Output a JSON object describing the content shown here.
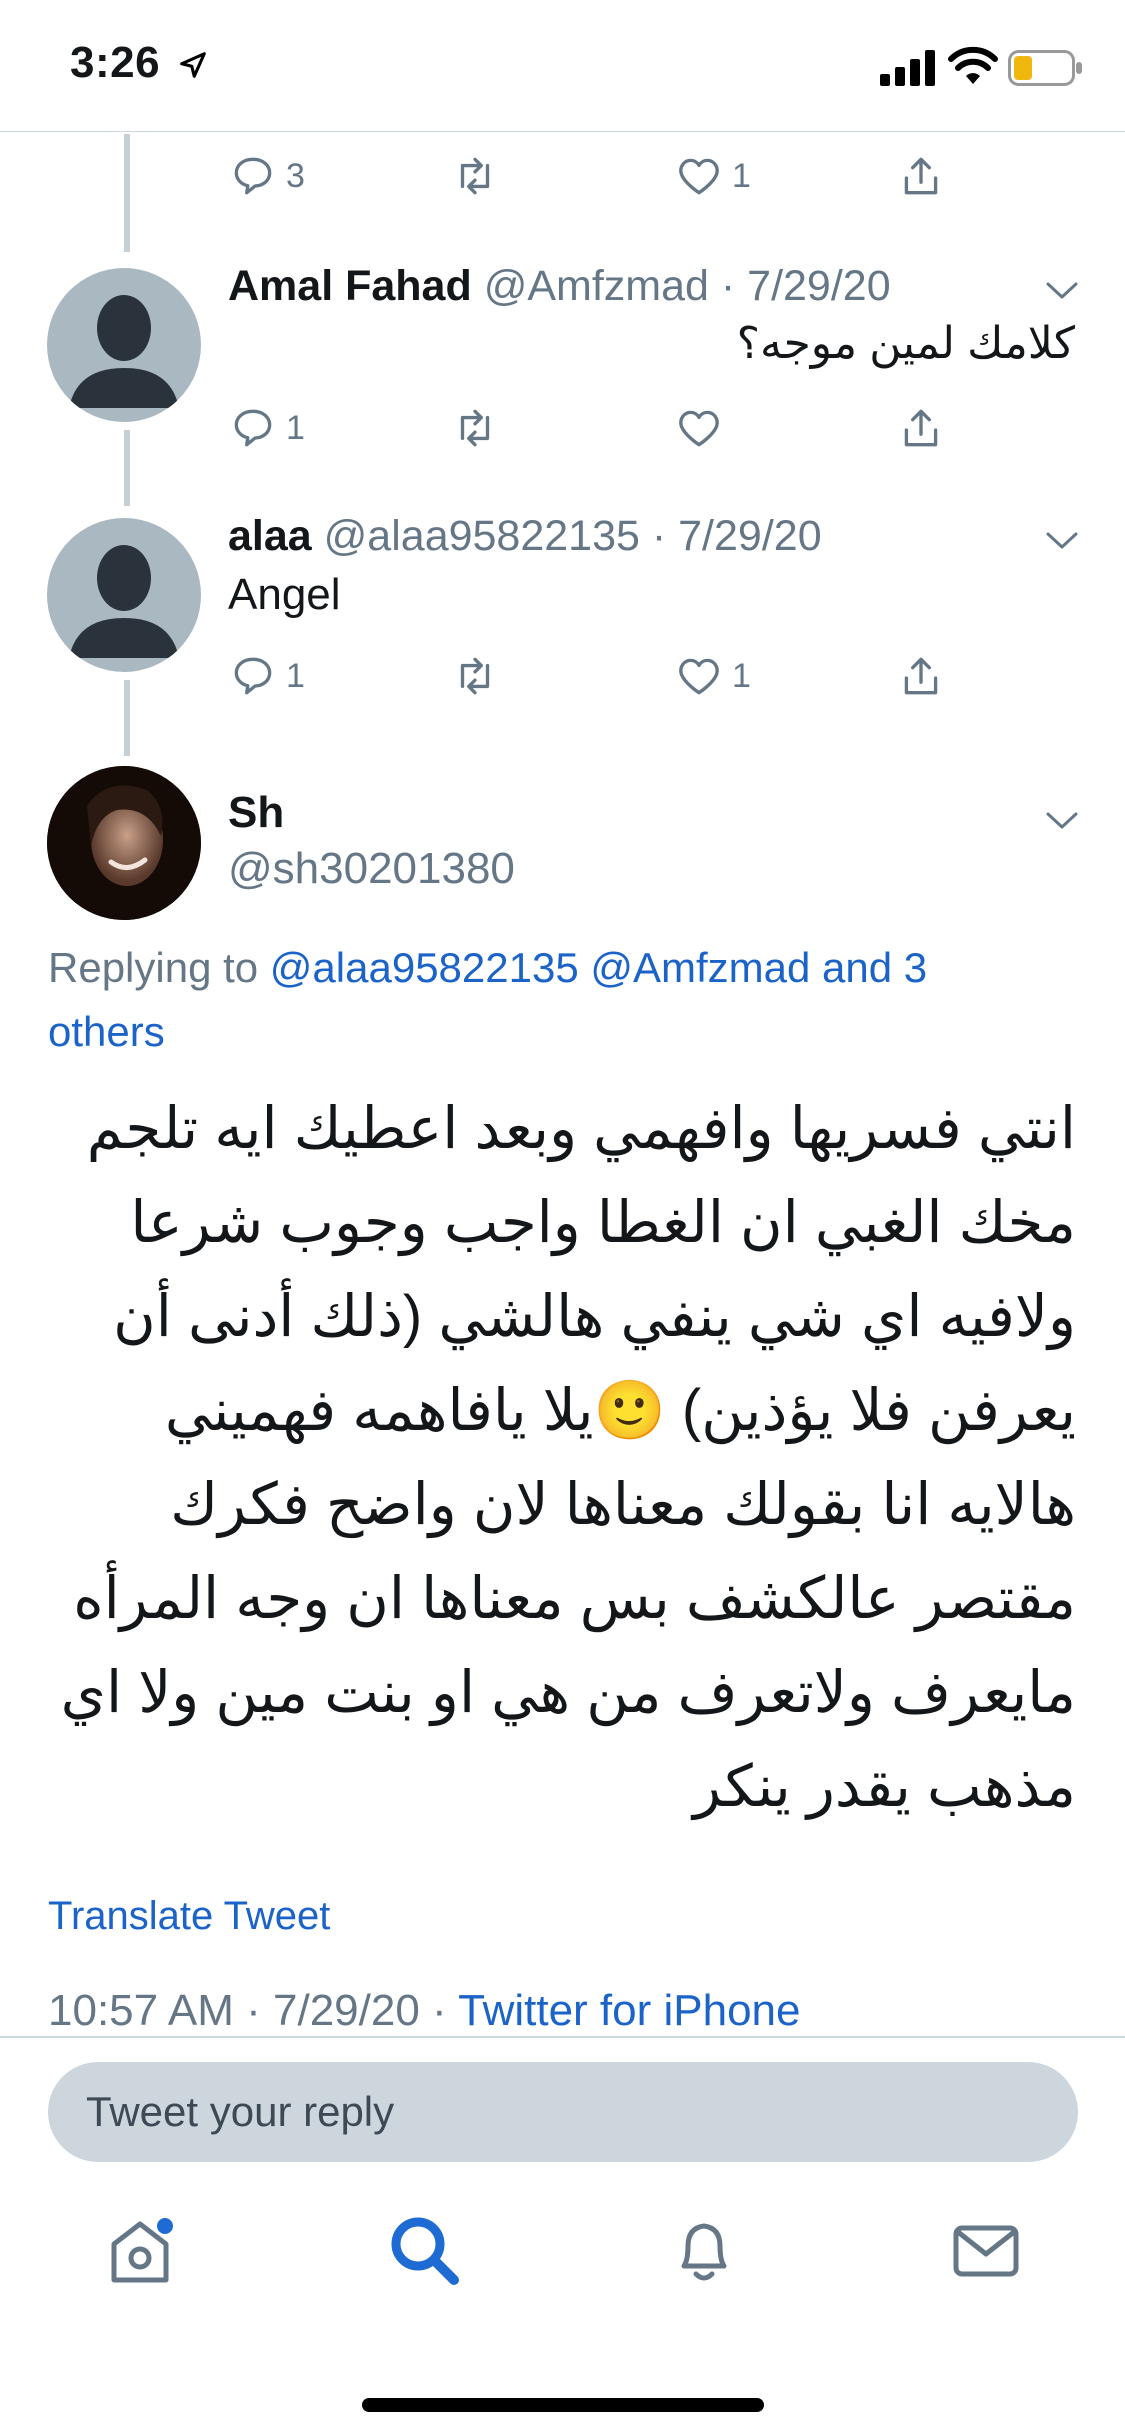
{
  "status_bar": {
    "time": "3:26"
  },
  "tweets": [
    {
      "actions": {
        "reply": "3",
        "retweet": "",
        "like": "1"
      }
    },
    {
      "name": "Amal Fahad",
      "handle": "@Amfzmad",
      "date": "· 7/29/20",
      "text": "كلامك لمين موجه؟",
      "actions": {
        "reply": "1",
        "retweet": "",
        "like": ""
      }
    },
    {
      "name": "alaa",
      "handle": "@alaa95822135",
      "date": "· 7/29/20",
      "text": "Angel",
      "actions": {
        "reply": "1",
        "retweet": "",
        "like": "1"
      }
    }
  ],
  "main_tweet": {
    "name": "Sh",
    "handle": "@sh30201380",
    "replying_prefix": "Replying to ",
    "replying_links": "@alaa95822135 @Amfzmad and 3 others",
    "text": "انتي فسريها وافهمي وبعد اعطيك ايه تلجم مخك الغبي ان الغطا واجب وجوب شرعا ولافيه اي شي ينفي هالشي (ذلك أدنى أن يعرفن فلا يؤذين) 🙂يلا يافاهمه فهميني هالايه انا بقولك معناها لان واضح فكرك مقتصر عالكشف بس معناها ان وجه المرأه مايعرف ولاتعرف من هي او بنت مين ولا اي مذهب يقدر ينكر",
    "translate": "Translate Tweet",
    "time": "10:57 AM · 7/29/20 · ",
    "source": "Twitter for iPhone"
  },
  "compose": {
    "placeholder": "Tweet your reply"
  },
  "tabs": [
    {
      "icon": "home-icon"
    },
    {
      "icon": "search-icon"
    },
    {
      "icon": "notifications-icon"
    },
    {
      "icon": "messages-icon"
    }
  ],
  "colors": {
    "accent": "#1b63c9",
    "muted": "#657786",
    "thread_line": "#c4cfd6"
  }
}
